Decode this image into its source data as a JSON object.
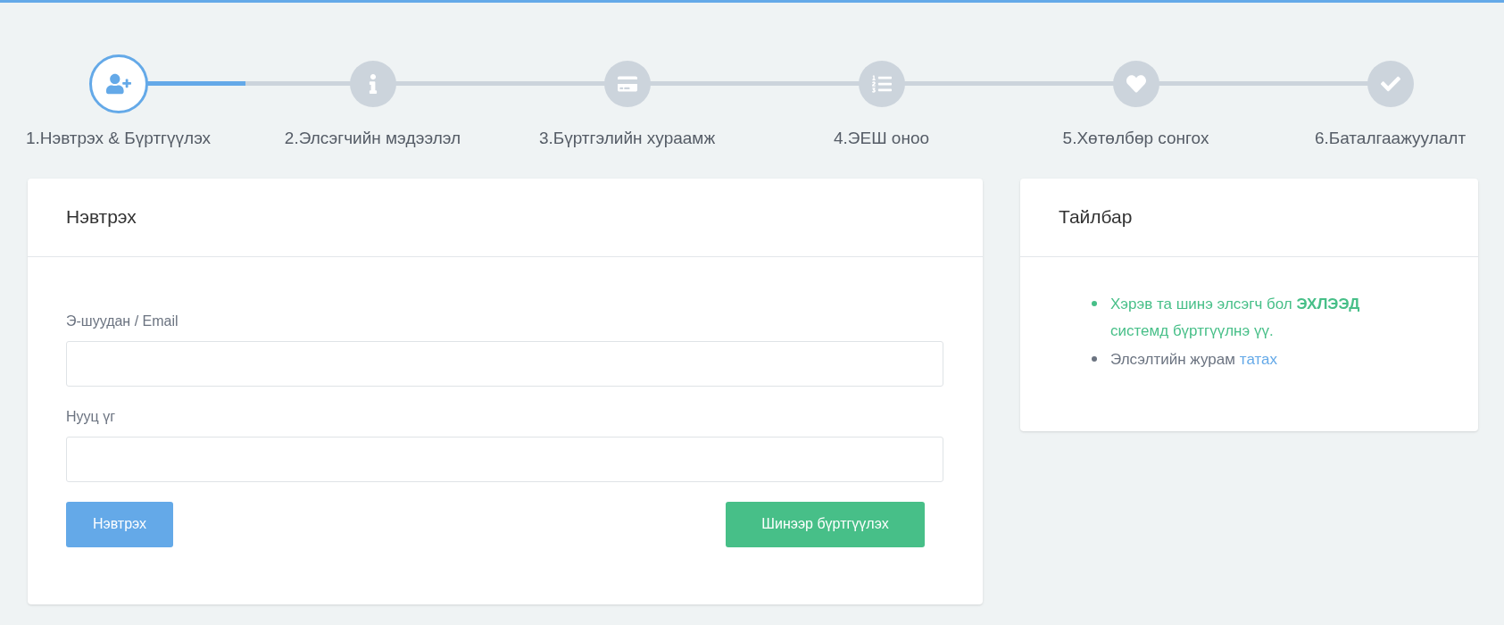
{
  "steps": [
    {
      "label": "1.Нэвтрэх & Бүртгүүлэх",
      "active": true
    },
    {
      "label": "2.Элсэгчийн мэдээлэл",
      "active": false
    },
    {
      "label": "3.Бүртгэлийн хураамж",
      "active": false
    },
    {
      "label": "4.ЭЕШ оноо",
      "active": false
    },
    {
      "label": "5.Хөтөлбөр сонгох",
      "active": false
    },
    {
      "label": "6.Баталгаажуулалт",
      "active": false
    }
  ],
  "login": {
    "title": "Нэвтрэх",
    "fields": [
      {
        "label": "Э-шуудан / Email"
      },
      {
        "label": "Нууц үг"
      }
    ],
    "login_button": "Нэвтрэх",
    "register_button": "Шинээр бүртгүүлэх"
  },
  "notes": {
    "title": "Тайлбар",
    "items": [
      {
        "kind": "highlight",
        "text": "Хэрэв та шинэ элсэгч бол **ЭХЛЭЭД** системд бүртгүүлнэ үү."
      },
      {
        "kind": "link",
        "text": "Элсэлтийн журам",
        "link": "татах"
      }
    ]
  }
}
